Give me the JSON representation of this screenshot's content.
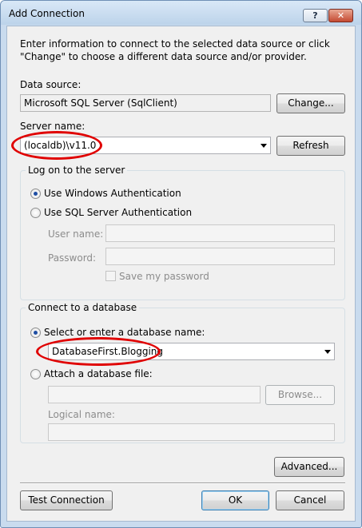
{
  "window": {
    "title": "Add Connection",
    "help_glyph": "?",
    "close_glyph": "✕"
  },
  "intro": "Enter information to connect to the selected data source or click \"Change\" to choose a different data source and/or provider.",
  "data_source": {
    "label": "Data source:",
    "value": "Microsoft SQL Server (SqlClient)",
    "change_button": "Change..."
  },
  "server": {
    "label": "Server name:",
    "value": "(localdb)\\v11.0",
    "refresh_button": "Refresh"
  },
  "logon": {
    "legend": "Log on to the server",
    "windows_auth": "Use Windows Authentication",
    "sql_auth": "Use SQL Server Authentication",
    "user_name_label": "User name:",
    "password_label": "Password:",
    "save_password": "Save my password"
  },
  "database": {
    "legend": "Connect to a database",
    "select_option": "Select or enter a database name:",
    "name_value": "DatabaseFirst.Blogging",
    "attach_option": "Attach a database file:",
    "browse_button": "Browse...",
    "logical_name_label": "Logical name:"
  },
  "buttons": {
    "advanced": "Advanced...",
    "test_connection": "Test Connection",
    "ok": "OK",
    "cancel": "Cancel"
  },
  "colors": {
    "highlight_ellipse": "#e00000",
    "radio_selected_dot": "#1f4ea3"
  }
}
